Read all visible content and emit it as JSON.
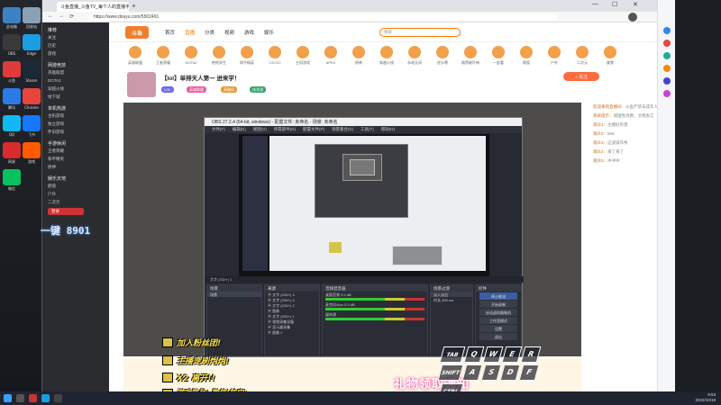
{
  "desktop": {
    "icons": [
      {
        "name": "computer-icon",
        "color": "#3b82c4",
        "label": "此电脑"
      },
      {
        "name": "recycle-bin-icon",
        "color": "#8aa0b4",
        "label": "回收站"
      },
      {
        "name": "app-icon-1",
        "color": "#3a3a3a",
        "label": "OBS"
      },
      {
        "name": "edge-icon",
        "color": "#1b9de2",
        "label": "Edge"
      },
      {
        "name": "app-icon-2",
        "color": "#e03a3a",
        "label": "斗鱼"
      },
      {
        "name": "steam-icon",
        "color": "#1b2838",
        "label": "Steam"
      },
      {
        "name": "app-icon-3",
        "color": "#2c7be5",
        "label": "腾讯"
      },
      {
        "name": "chrome-icon",
        "color": "#e8453c",
        "label": "Chrome"
      },
      {
        "name": "qq-icon",
        "color": "#12b7f5",
        "label": "QQ"
      },
      {
        "name": "app-icon-4",
        "color": "#1677ff",
        "label": "飞书"
      },
      {
        "name": "app-icon-5",
        "color": "#d92b2b",
        "label": "网易"
      },
      {
        "name": "app-icon-6",
        "color": "#ff5a00",
        "label": "游戏"
      },
      {
        "name": "wechat-icon",
        "color": "#07c160",
        "label": "微信"
      }
    ]
  },
  "browser": {
    "tab_title": "斗鱼直播_斗鱼TV_每个人的直播平台",
    "url": "https://www.douyu.com/5502491",
    "new_tab": "+",
    "minimize": "—",
    "maximize": "☐",
    "close": "✕"
  },
  "site": {
    "logo": "斗鱼",
    "nav": [
      "首页",
      "直播",
      "分类",
      "视频",
      "游戏",
      "娱乐"
    ],
    "search_placeholder": "搜索",
    "categories": [
      "英雄联盟",
      "王者荣耀",
      "DOTA2",
      "绝地求生",
      "和平精英",
      "CS:GO",
      "主机游戏",
      "APEX",
      "原神",
      "穿越火线",
      "永劫无间",
      "逆水寒",
      "暗黑破坏神",
      "一起看",
      "颜值",
      "户外",
      "二次元",
      "美食"
    ],
    "sidebar": {
      "sections": [
        {
          "head": "推荐",
          "items": [
            "关注",
            "历史",
            "游戏"
          ]
        },
        {
          "head": "网游竞技",
          "items": [
            "英雄联盟",
            "DOTA2",
            "穿越火线",
            "地下城"
          ]
        },
        {
          "head": "单机热游",
          "items": [
            "主机游戏",
            "独立游戏",
            "怀旧游戏"
          ]
        },
        {
          "head": "手游休闲",
          "items": [
            "王者荣耀",
            "和平精英",
            "原神"
          ]
        },
        {
          "head": "娱乐天地",
          "items": [
            "颜值",
            "户外",
            "二次元"
          ]
        }
      ],
      "login_btn": "登录"
    },
    "room": {
      "title": "【lol】单排天人第一 进来学！",
      "follow": "+ 关注",
      "tags": [
        "LOL",
        "英雄联盟",
        "高端局",
        "技术流"
      ]
    },
    "chat": [
      {
        "user": "欢迎来到直播间",
        "text": "斗鱼严禁未成年人直播或打赏"
      },
      {
        "user": "系统提示",
        "text": "请理性消费，文明发言"
      },
      {
        "user": "观众1",
        "text": "主播好厉害"
      },
      {
        "user": "观众2",
        "text": "666"
      },
      {
        "user": "观众3",
        "text": "这波操作秀"
      },
      {
        "user": "观众4",
        "text": "来了来了"
      },
      {
        "user": "观众5",
        "text": "冲冲冲"
      }
    ],
    "gift_banner": "礼物领取通知"
  },
  "obs": {
    "title": "OBS 27.2.4 (64-bit, windows) - 配置文件: 未命名 - 场景: 未命名",
    "menu": [
      "文件(F)",
      "编辑(E)",
      "视图(V)",
      "停靠部件(D)",
      "配置文件(P)",
      "场景集合(S)",
      "工具(T)",
      "帮助(H)"
    ],
    "source_bar": "文字 (GDI+) 1",
    "docks": {
      "scenes": {
        "head": "场景",
        "items": [
          "场景"
        ]
      },
      "sources": {
        "head": "来源",
        "items": [
          "文字 (GDI+) 4",
          "文字 (GDI+) 3",
          "文字 (GDI+) 2",
          "图像",
          "文字 (GDI+) 1",
          "视频采集设备",
          "显示器采集",
          "图像 2"
        ]
      },
      "mixer": {
        "head": "音频混音器",
        "items": [
          "桌面音频 0.0 dB",
          "麦克风/Aux 0.0 dB",
          "媒体源"
        ]
      },
      "transitions": {
        "head": "场景过渡",
        "items": [
          "淡入淡出",
          "时长 300 ms"
        ]
      },
      "controls": {
        "head": "控件",
        "items": [
          "停止推流",
          "开始录制",
          "启动虚拟摄像机",
          "工作室模式",
          "设置",
          "退出"
        ]
      }
    }
  },
  "overlay": {
    "clock": "一键 8901",
    "lines": [
      "加入粉丝团!",
      "主播宠刷炮炮!",
      "X2 离开!!",
      "游戏账号+微信(待定)"
    ],
    "keys_row1": [
      "TAB",
      "Q",
      "W",
      "E",
      "R"
    ],
    "keys_row2": [
      "SHIFT",
      "A",
      "S",
      "D",
      "F"
    ],
    "keys_row3": [
      "CTRL"
    ]
  },
  "taskbar": {
    "time": "9:53",
    "date": "2022/10/19"
  }
}
